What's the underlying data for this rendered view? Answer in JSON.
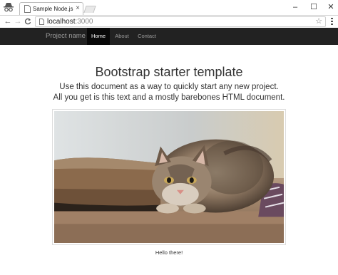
{
  "browser": {
    "tab_title": "Sample Node.js",
    "tab_close": "×",
    "window_minimize": "–",
    "window_maximize": "☐",
    "window_close": "✕",
    "back": "←",
    "forward": "→",
    "reload": "C",
    "url_host": "localhost",
    "url_port": ":3000",
    "bookmark": "☆"
  },
  "navbar": {
    "brand": "Project name",
    "items": [
      {
        "label": "Home",
        "active": true
      },
      {
        "label": "About",
        "active": false
      },
      {
        "label": "Contact",
        "active": false
      }
    ]
  },
  "main": {
    "headline": "Bootstrap starter template",
    "lead_line1": "Use this document as a way to quickly start any new project.",
    "lead_line2": "All you get is this text and a mostly barebones HTML document.",
    "caption": "Hello there!"
  },
  "colors": {
    "navbar_bg": "#222222",
    "navbar_active_bg": "#080808",
    "navbar_text": "#9d9d9d",
    "text": "#333333"
  },
  "icons": [
    "incognito-icon",
    "page-icon",
    "back-icon",
    "forward-icon",
    "reload-icon",
    "star-icon",
    "menu-icon"
  ]
}
